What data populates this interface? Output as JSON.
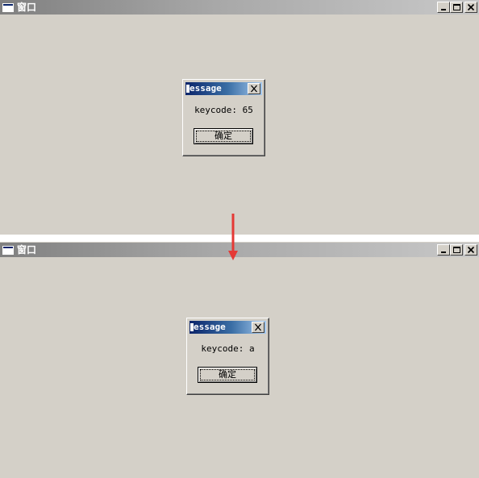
{
  "top_window": {
    "title": "窗口",
    "dialog": {
      "title": "essage",
      "message": "keycode: 65",
      "ok_label": "确定"
    }
  },
  "bottom_window": {
    "title": "窗口",
    "dialog": {
      "title": "essage",
      "message": "keycode: a",
      "ok_label": "确定"
    }
  },
  "colors": {
    "window_bg": "#d4d0c8",
    "dialog_title_start": "#0a246a",
    "arrow": "#e53935"
  },
  "icons": {
    "minimize": "minimize-icon",
    "maximize": "maximize-icon",
    "close": "close-icon",
    "app": "window-app-icon",
    "arrow": "down-arrow-icon"
  }
}
